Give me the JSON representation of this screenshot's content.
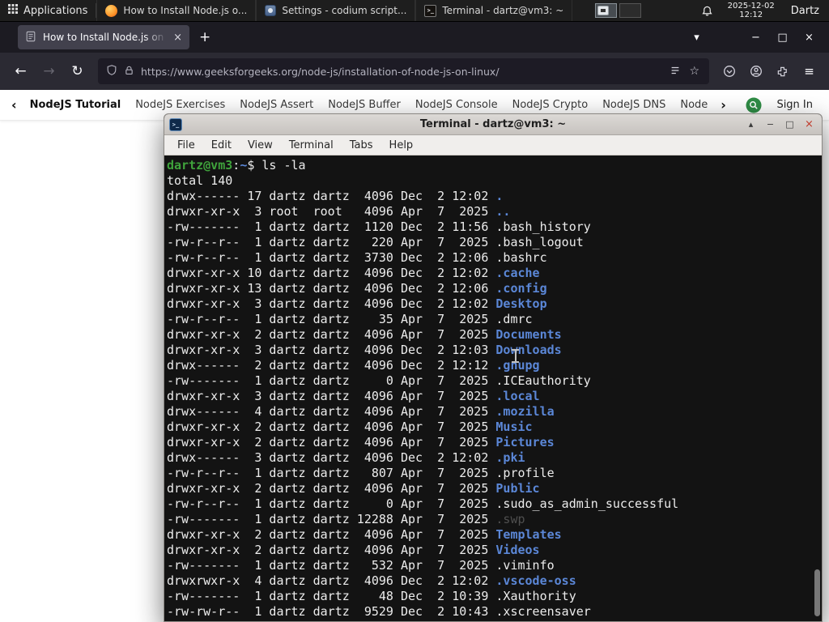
{
  "panel": {
    "applications_label": "Applications",
    "taskbar": [
      {
        "title": "How to Install Node.js o...",
        "icon": "firefox"
      },
      {
        "title": "Settings - codium script...",
        "icon": "settings"
      },
      {
        "title": "Terminal - dartz@vm3: ~",
        "icon": "terminal"
      }
    ],
    "clock_date": "2025-12-02",
    "clock_time": "12:12",
    "user": "Dartz"
  },
  "browser": {
    "tab_title": "How to Install Node.js on",
    "url": "https://www.geeksforgeeks.org/node-js/installation-of-node-js-on-linux/",
    "nav_links": [
      "NodeJS Tutorial",
      "NodeJS Exercises",
      "NodeJS Assert",
      "NodeJS Buffer",
      "NodeJS Console",
      "NodeJS Crypto",
      "NodeJS DNS",
      "Node"
    ],
    "sign_in_label": "Sign In",
    "accent_green": "#2f8d46"
  },
  "terminal": {
    "title": "Terminal - dartz@vm3: ~",
    "menu": [
      "File",
      "Edit",
      "View",
      "Terminal",
      "Tabs",
      "Help"
    ],
    "prompt": {
      "user_host": "dartz@vm3",
      "separator": ":",
      "path": "~",
      "symbol": "$",
      "command": "ls -la"
    },
    "total_line": "total 140",
    "colors": {
      "bg": "#131313",
      "file": "#ececec",
      "dir": "#5b87d7",
      "dim": "#4f4f4f",
      "green": "#3fa33c"
    },
    "listing": [
      {
        "pre": "drwx------ 17 dartz dartz  4096 Dec  2 12:02 ",
        "name": ".",
        "type": "dir"
      },
      {
        "pre": "drwxr-xr-x  3 root  root   4096 Apr  7  2025 ",
        "name": "..",
        "type": "dir"
      },
      {
        "pre": "-rw-------  1 dartz dartz  1120 Dec  2 11:56 ",
        "name": ".bash_history",
        "type": "file"
      },
      {
        "pre": "-rw-r--r--  1 dartz dartz   220 Apr  7  2025 ",
        "name": ".bash_logout",
        "type": "file"
      },
      {
        "pre": "-rw-r--r--  1 dartz dartz  3730 Dec  2 12:06 ",
        "name": ".bashrc",
        "type": "file"
      },
      {
        "pre": "drwxr-xr-x 10 dartz dartz  4096 Dec  2 12:02 ",
        "name": ".cache",
        "type": "dir"
      },
      {
        "pre": "drwxr-xr-x 13 dartz dartz  4096 Dec  2 12:06 ",
        "name": ".config",
        "type": "dir"
      },
      {
        "pre": "drwxr-xr-x  3 dartz dartz  4096 Dec  2 12:02 ",
        "name": "Desktop",
        "type": "dir"
      },
      {
        "pre": "-rw-r--r--  1 dartz dartz    35 Apr  7  2025 ",
        "name": ".dmrc",
        "type": "file"
      },
      {
        "pre": "drwxr-xr-x  2 dartz dartz  4096 Apr  7  2025 ",
        "name": "Documents",
        "type": "dir"
      },
      {
        "pre": "drwxr-xr-x  3 dartz dartz  4096 Dec  2 12:03 ",
        "name": "Downloads",
        "type": "dir"
      },
      {
        "pre": "drwx------  2 dartz dartz  4096 Dec  2 12:12 ",
        "name": ".gnupg",
        "type": "dir"
      },
      {
        "pre": "-rw-------  1 dartz dartz     0 Apr  7  2025 ",
        "name": ".ICEauthority",
        "type": "file"
      },
      {
        "pre": "drwxr-xr-x  3 dartz dartz  4096 Apr  7  2025 ",
        "name": ".local",
        "type": "dir"
      },
      {
        "pre": "drwx------  4 dartz dartz  4096 Apr  7  2025 ",
        "name": ".mozilla",
        "type": "dir"
      },
      {
        "pre": "drwxr-xr-x  2 dartz dartz  4096 Apr  7  2025 ",
        "name": "Music",
        "type": "dir"
      },
      {
        "pre": "drwxr-xr-x  2 dartz dartz  4096 Apr  7  2025 ",
        "name": "Pictures",
        "type": "dir"
      },
      {
        "pre": "drwx------  3 dartz dartz  4096 Dec  2 12:02 ",
        "name": ".pki",
        "type": "dir"
      },
      {
        "pre": "-rw-r--r--  1 dartz dartz   807 Apr  7  2025 ",
        "name": ".profile",
        "type": "file"
      },
      {
        "pre": "drwxr-xr-x  2 dartz dartz  4096 Apr  7  2025 ",
        "name": "Public",
        "type": "dir"
      },
      {
        "pre": "-rw-r--r--  1 dartz dartz     0 Apr  7  2025 ",
        "name": ".sudo_as_admin_successful",
        "type": "file"
      },
      {
        "pre": "-rw-------  1 dartz dartz 12288 Apr  7  2025 ",
        "name": ".swp",
        "type": "dim"
      },
      {
        "pre": "drwxr-xr-x  2 dartz dartz  4096 Apr  7  2025 ",
        "name": "Templates",
        "type": "dir"
      },
      {
        "pre": "drwxr-xr-x  2 dartz dartz  4096 Apr  7  2025 ",
        "name": "Videos",
        "type": "dir"
      },
      {
        "pre": "-rw-------  1 dartz dartz   532 Apr  7  2025 ",
        "name": ".viminfo",
        "type": "file"
      },
      {
        "pre": "drwxrwxr-x  4 dartz dartz  4096 Dec  2 12:02 ",
        "name": ".vscode-oss",
        "type": "dir"
      },
      {
        "pre": "-rw-------  1 dartz dartz    48 Dec  2 10:39 ",
        "name": ".Xauthority",
        "type": "file"
      },
      {
        "pre": "-rw-rw-r--  1 dartz dartz  9529 Dec  2 10:43 ",
        "name": ".xscreensaver",
        "type": "file"
      }
    ]
  },
  "icons": {
    "terminal_glyph": ">_",
    "new_tab": "+",
    "list_tabs": "▾",
    "minimize": "−",
    "maximize": "□",
    "close": "×",
    "shade": "▴",
    "back": "←",
    "forward": "→",
    "reload": "↻",
    "chevron_left": "‹",
    "chevron_right": "›",
    "menu": "≡",
    "star": "☆"
  }
}
